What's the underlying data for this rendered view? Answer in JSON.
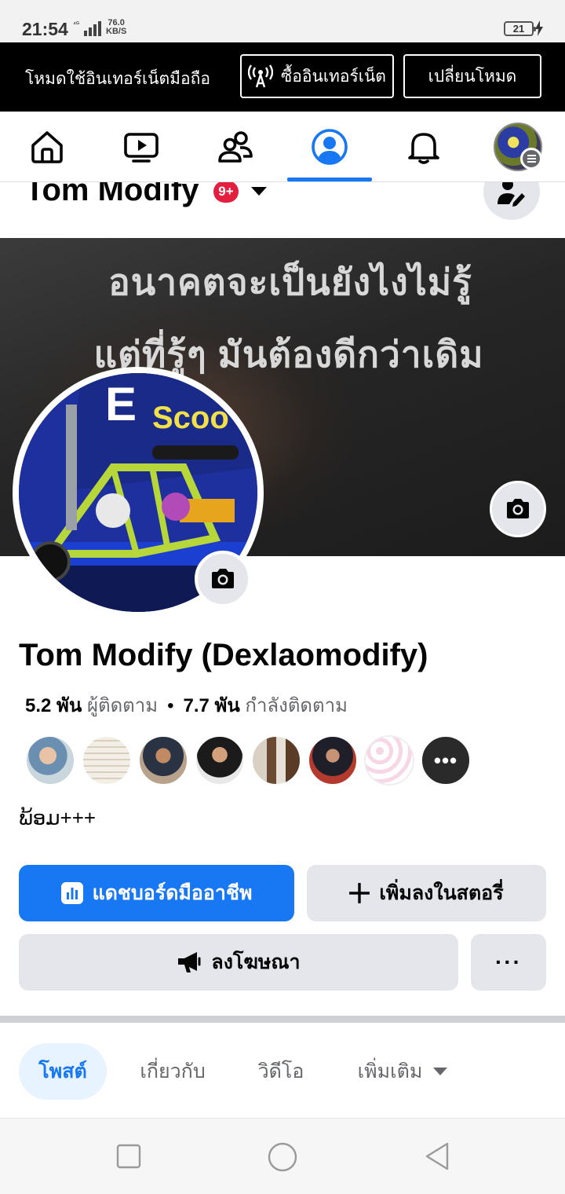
{
  "status_bar": {
    "time": "21:54",
    "network": "4G",
    "speed_value": "76.0",
    "speed_unit": "KB/S",
    "battery": "21"
  },
  "mode_banner": {
    "label": "โหมดใช้อินเทอร์เน็ตมือถือ",
    "buy_label": "ซื้ออินเทอร์เน็ต",
    "switch_label": "เปลี่ยนโหมด"
  },
  "nav": {
    "items": [
      "home-icon",
      "watch-icon",
      "friends-icon",
      "profile-icon",
      "notifications-icon",
      "account-menu"
    ],
    "active": "profile-icon",
    "accent": "#1877f2"
  },
  "sticky_header": {
    "name": "Tom Modify",
    "badge": "9+"
  },
  "cover": {
    "line1": "อนาคตจะเป็นยังไงไม่รู้",
    "line2": "แต่ที่รู้ๆ มันต้องดีกว่าเดิม"
  },
  "profile": {
    "name": "Tom Modify (Dexlaomodify)",
    "followers_count": "5.2 พัน",
    "followers_label": "ผู้ติดตาม",
    "following_count": "7.7 พัน",
    "following_label": "กำลังติดตาม",
    "friend_avatars": 7,
    "bio": "ພ້ອມ+++"
  },
  "actions": {
    "dashboard": "แดชบอร์ดมืออาชีพ",
    "add_story": "เพิ่มลงในสตอรี่",
    "advertise": "ลงโฆษณา",
    "more": "···"
  },
  "tabs": {
    "posts": "โพสต์",
    "about": "เกี่ยวกับ",
    "videos": "วิดีโอ",
    "more": "เพิ่มเติม"
  },
  "colors": {
    "brand": "#1877f2",
    "badge": "#e41e3f",
    "button_gray": "#e4e6eb"
  }
}
